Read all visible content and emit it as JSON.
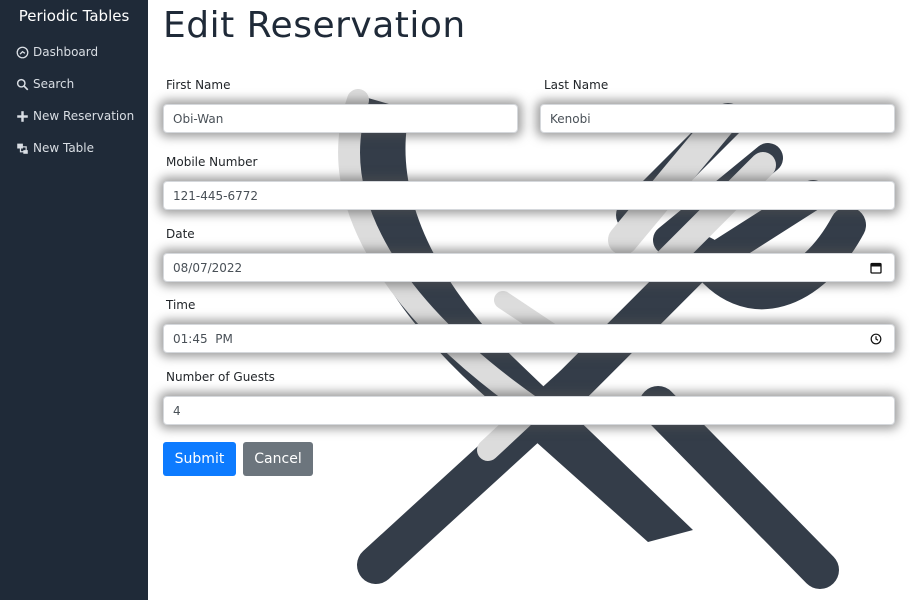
{
  "sidebar": {
    "brand": "Periodic Tables",
    "items": [
      {
        "label": "Dashboard",
        "icon": "dashboard-icon"
      },
      {
        "label": "Search",
        "icon": "search-icon"
      },
      {
        "label": "New Reservation",
        "icon": "plus-icon"
      },
      {
        "label": "New Table",
        "icon": "layers-icon"
      }
    ]
  },
  "main": {
    "title": "Edit Reservation",
    "form": {
      "first_name": {
        "label": "First Name",
        "value": "Obi-Wan"
      },
      "last_name": {
        "label": "Last Name",
        "value": "Kenobi"
      },
      "mobile": {
        "label": "Mobile Number",
        "value": "121-445-6772"
      },
      "date": {
        "label": "Date",
        "value": "08/07/2022",
        "icon": "calendar-icon"
      },
      "time": {
        "label": "Time",
        "value": "01:45  PM",
        "icon": "clock-icon"
      },
      "guests": {
        "label": "Number of Guests",
        "value": "4"
      }
    },
    "buttons": {
      "submit": "Submit",
      "cancel": "Cancel"
    }
  },
  "colors": {
    "sidebar_bg": "#1f2a38",
    "submit": "#0d7bff",
    "cancel": "#6c757d",
    "background_art_dark": "#343d49",
    "background_art_light": "#dcdcdc"
  },
  "background_art": "fork-and-knife-icon"
}
